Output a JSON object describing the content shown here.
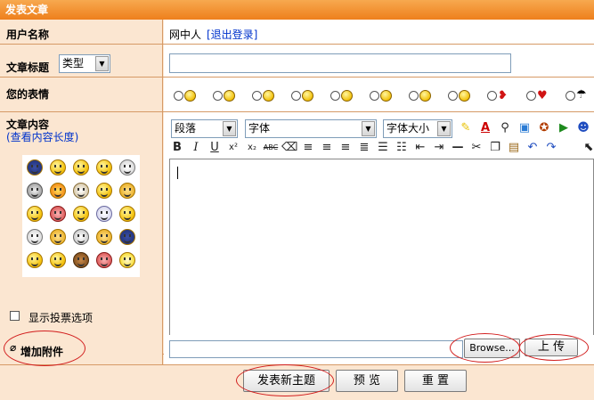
{
  "header": {
    "title": "发表文章"
  },
  "user": {
    "label": "用户名称",
    "name": "网中人",
    "logout": "[退出登录]"
  },
  "subject": {
    "label": "文章标题",
    "type_select": "类型",
    "value": ""
  },
  "mood": {
    "label": "您的表情"
  },
  "content": {
    "label": "文章内容",
    "check_length": "(查看内容长度)",
    "vote_option": "显示投票选项",
    "paragraph_select": "段落",
    "font_select": "字体",
    "size_select": "字体大小",
    "body": ""
  },
  "attachment": {
    "label": "增加附件",
    "browse": "Browse...",
    "upload": "上 传"
  },
  "actions": {
    "submit": "发表新主题",
    "preview": "预 览",
    "reset": "重 置"
  },
  "colors": {
    "header": "#ee7f1c",
    "label_bg": "#fbe6d1",
    "border": "#d69a66",
    "annotation": "#d21e1e"
  }
}
